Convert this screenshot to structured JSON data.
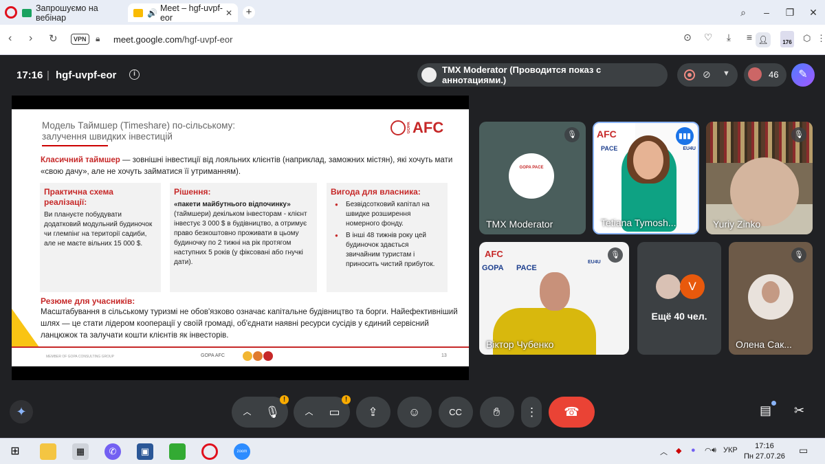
{
  "browser": {
    "tabs": [
      {
        "title": "Запрошуємо на вебінар"
      },
      {
        "title": "Meet – hgf-uvpf-eor"
      }
    ],
    "vpn_label": "VPN",
    "url_host": "meet.google.com",
    "url_path": "/hgf-uvpf-eor",
    "extension_badge": "176"
  },
  "meet": {
    "time": "17:16",
    "separator": "|",
    "meeting_code": "hgf-uvpf-eor",
    "presenter_text": "TMX Moderator (Проводится показ с аннотациями.)",
    "participants_count": "46",
    "more_people": "Ещё 40 чел.",
    "more_avatar_letter": "V"
  },
  "slide": {
    "title": "Модель Таймшер (Timeshare) по-сільському: залучення швидких інвестицій",
    "logo": "AFC",
    "logo_side": "GOPA",
    "intro_term": "Класичний таймшер",
    "intro_text": " — зовнішні інвестиції від лояльних клієнтів (наприклад, заможних містян), які хочуть мати «свою дачу», але не хочуть займатися її утриманням).",
    "box1_title": "Практична схема реалізації:",
    "box1_text": "Ви плануєте побудувати додатковий модульний будиночок чи глемпінг на території садиби, але не маєте вільних 15 000 $.",
    "box2_title": "Рішення:",
    "box2_bold": "«пакети майбутнього відпочинку»",
    "box2_text": "(таймшери) декільком інвесторам - клієнт інвестує 3 000 $ в будівництво, а отримує право безкоштовно проживати в цьому будиночку по 2 тижні на рік протягом наступних 5 років (у фіксовані або гнучкі дати).",
    "box3_title": "Вигода для власника:",
    "box3_items": [
      "Безвідсотковий капітал на швидке розширення номерного фонду.",
      "В інші 48 тижнів року цей будиночок здається звичайним туристам і приносить чистий прибуток."
    ],
    "summary_title": "Резюме для учасників:",
    "summary_text": "Масштабування в сільському туризмі не обов'язково означає капітальне будівництво та борги. Найефективніший шлях — це стати лідером кооперації у своїй громаді, об'єднати наявні ресурси сусідів у єдиний сервісний ланцюжок та залучати кошти клієнтів як інвесторів.",
    "footer_left": "MEMBER OF GOPA CONSULTING GROUP",
    "footer_center": "GOPA AFC",
    "page_number": "13"
  },
  "tiles": [
    {
      "name": "TMX Moderator"
    },
    {
      "name": "Tetiana Tymosh..."
    },
    {
      "name": "Yuriy Zinko"
    },
    {
      "name": "Віктор Чубенко"
    },
    {
      "name": "Олена Сак..."
    }
  ],
  "tile_logos": {
    "afc": "AFC",
    "gopa": "GOPA",
    "pace": "PACE",
    "eu4u": "EU4U",
    "avatar_text": "GOPA PACE"
  },
  "taskbar": {
    "lang": "УКР",
    "time": "17:16",
    "date": "Пн 27.07.26",
    "zoom_label": "zoom"
  },
  "colors": {
    "accent_red": "#c62828",
    "meet_bg": "#202124",
    "end_call": "#ea4335",
    "warning": "#f9ab00"
  },
  "icons": [
    "opera-icon",
    "speaker-icon",
    "close-icon",
    "new-tab-icon",
    "search-icon",
    "back-icon",
    "forward-icon",
    "reload-icon",
    "lock-icon",
    "camera-icon",
    "heart-icon",
    "download-icon",
    "menu-icon",
    "profile-icon",
    "info-icon",
    "record-icon",
    "captions-off-icon",
    "chevron-down-icon",
    "ai-annotate-icon",
    "mic-off-icon",
    "mic-icon",
    "camera-video-icon",
    "present-icon",
    "emoji-icon",
    "captions-icon",
    "raise-hand-icon",
    "more-icon",
    "end-call-icon",
    "gemini-icon",
    "chat-icon",
    "tools-icon",
    "windows-icon"
  ]
}
